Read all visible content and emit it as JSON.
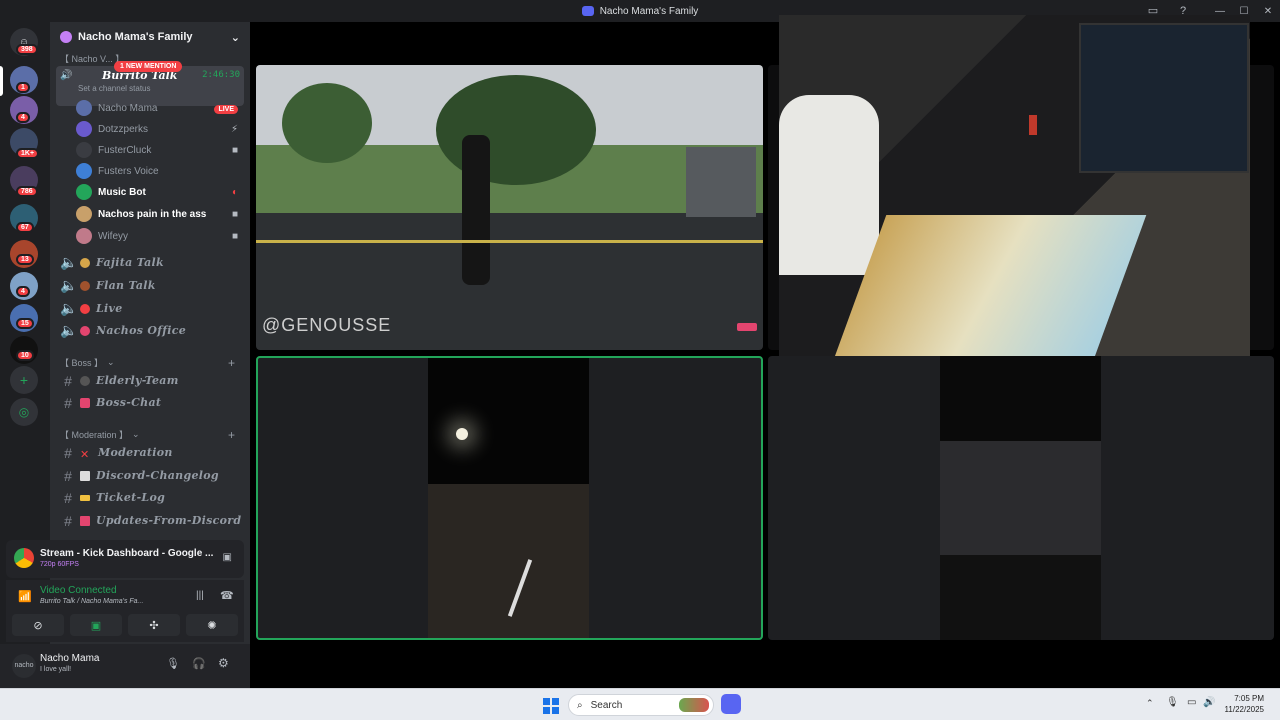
{
  "window": {
    "title": "Nacho Mama's Family"
  },
  "rail": {
    "badges": [
      "398",
      "1",
      "4",
      "1K+",
      "786",
      "67",
      "13",
      "4",
      "15",
      "10"
    ]
  },
  "server": {
    "name": "Nacho Mama's Family",
    "category_top": "【 Nacho V... 】",
    "active_channel": "Burrito Talk",
    "new_mention": "1 NEW MENTION",
    "channel_status": "Set a channel status",
    "timer": "2:46:30",
    "members": [
      {
        "name": "Nacho Mama",
        "tag": "LIVE"
      },
      {
        "name": "Dotzzperks",
        "tag": ""
      },
      {
        "name": "FusterCluck",
        "tag": ""
      },
      {
        "name": "Fusters Voice",
        "tag": ""
      },
      {
        "name": "Music Bot",
        "tag": ""
      },
      {
        "name": "Nachos pain in the ass",
        "tag": ""
      },
      {
        "name": "Wifeyy",
        "tag": ""
      }
    ],
    "voice_channels": [
      "Fajita Talk",
      "Flan Talk",
      "Live",
      "Nachos Office"
    ],
    "cat_boss": "【 Boss 】",
    "boss_channels": [
      "Elderly-Team",
      "Boss-Chat"
    ],
    "cat_mod": "【 Moderation 】",
    "mod_channels": [
      "Moderation",
      "Discord-Changelog",
      "Ticket-Log",
      "Updates-From-Discord"
    ]
  },
  "stream": {
    "title": "Stream - Kick Dashboard - Google ...",
    "quality": "720p 60FPS"
  },
  "voice": {
    "status": "Video Connected",
    "location": "Burrito Talk / Nacho Mama's Fa..."
  },
  "user": {
    "name": "Nacho Mama",
    "status": "I love yall!"
  },
  "tiles": {
    "watermark": "@GENOUSSE"
  },
  "taskbar": {
    "search_placeholder": "Search",
    "time": "7:05 PM",
    "date": "11/22/2025"
  }
}
